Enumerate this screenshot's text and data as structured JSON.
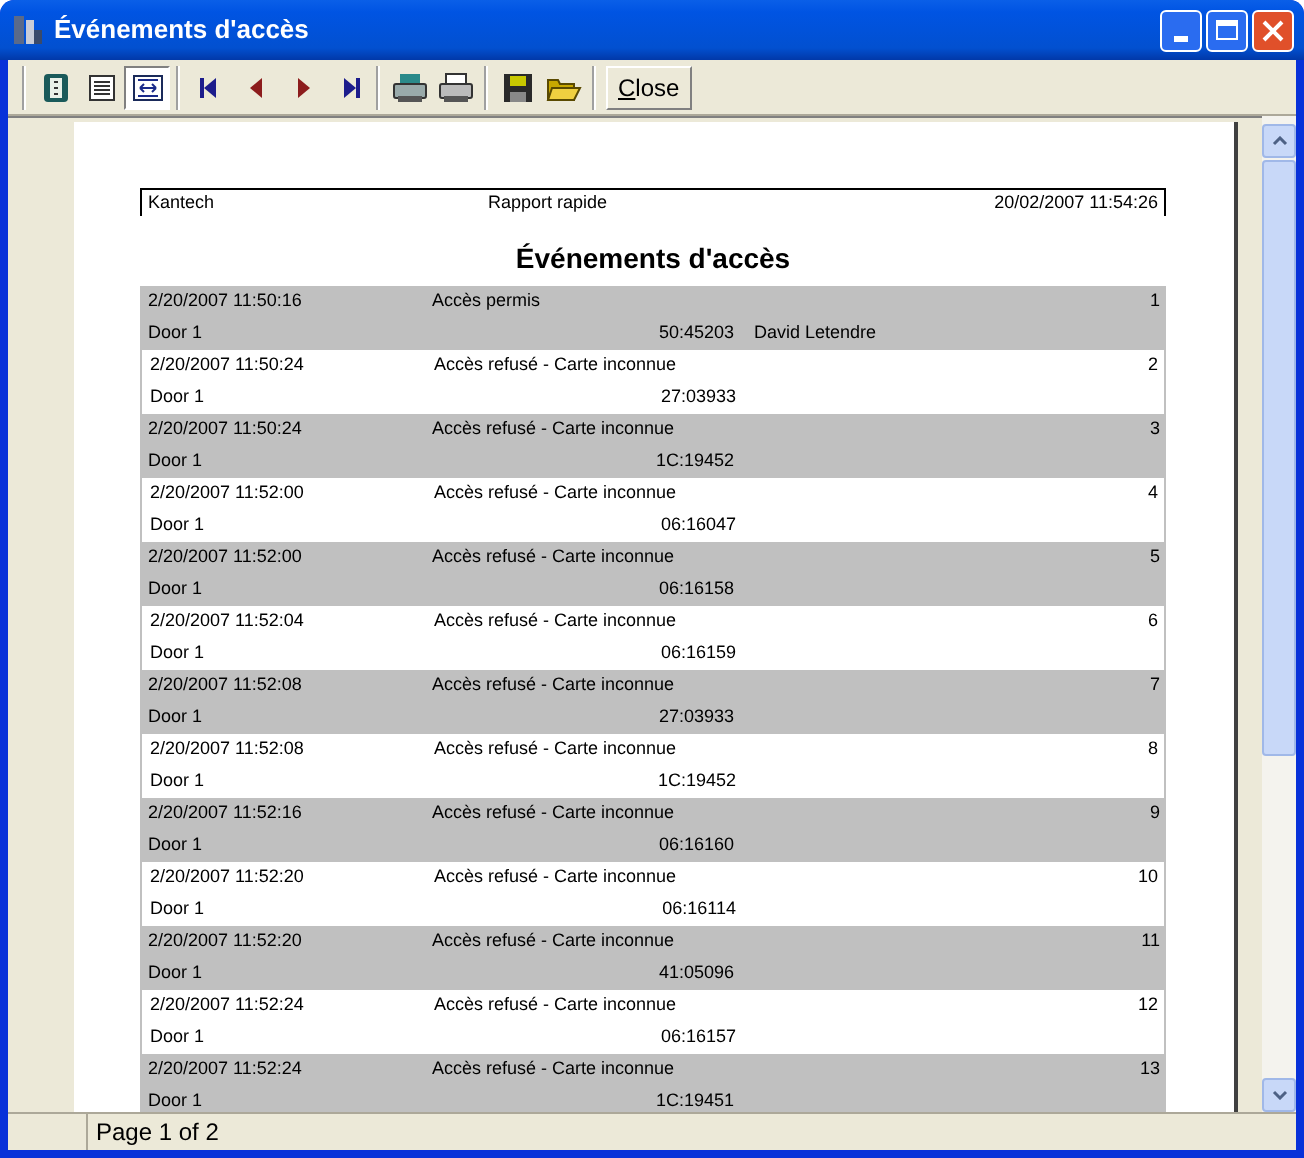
{
  "window": {
    "title": "Événements d'accès"
  },
  "toolbar": {
    "view_buttons": [
      {
        "selected": false
      },
      {
        "selected": false
      },
      {
        "selected": true
      }
    ],
    "close_button": "Close"
  },
  "report": {
    "header": {
      "company": "Kantech",
      "report_name": "Rapport rapide",
      "printed_at": "20/02/2007 11:54:26"
    },
    "title": "Événements d'accès",
    "rows": [
      {
        "date": "2/20/2007 11:50:16",
        "event": "Accès permis",
        "number": "1",
        "door": "Door 1",
        "card": "50:45203",
        "name": "David Letendre"
      },
      {
        "date": "2/20/2007 11:50:24",
        "event": "Accès refusé - Carte inconnue",
        "number": "2",
        "door": "Door 1",
        "card": "27:03933"
      },
      {
        "date": "2/20/2007 11:50:24",
        "event": "Accès refusé - Carte inconnue",
        "number": "3",
        "door": "Door 1",
        "card": "1C:19452"
      },
      {
        "date": "2/20/2007 11:52:00",
        "event": "Accès refusé - Carte inconnue",
        "number": "4",
        "door": "Door 1",
        "card": "06:16047"
      },
      {
        "date": "2/20/2007 11:52:00",
        "event": "Accès refusé - Carte inconnue",
        "number": "5",
        "door": "Door 1",
        "card": "06:16158"
      },
      {
        "date": "2/20/2007 11:52:04",
        "event": "Accès refusé - Carte inconnue",
        "number": "6",
        "door": "Door 1",
        "card": "06:16159"
      },
      {
        "date": "2/20/2007 11:52:08",
        "event": "Accès refusé - Carte inconnue",
        "number": "7",
        "door": "Door 1",
        "card": "27:03933"
      },
      {
        "date": "2/20/2007 11:52:08",
        "event": "Accès refusé - Carte inconnue",
        "number": "8",
        "door": "Door 1",
        "card": "1C:19452"
      },
      {
        "date": "2/20/2007 11:52:16",
        "event": "Accès refusé - Carte inconnue",
        "number": "9",
        "door": "Door 1",
        "card": "06:16160"
      },
      {
        "date": "2/20/2007 11:52:20",
        "event": "Accès refusé - Carte inconnue",
        "number": "10",
        "door": "Door 1",
        "card": "06:16114"
      },
      {
        "date": "2/20/2007 11:52:20",
        "event": "Accès refusé - Carte inconnue",
        "number": "11",
        "door": "Door 1",
        "card": "41:05096"
      },
      {
        "date": "2/20/2007 11:52:24",
        "event": "Accès refusé - Carte inconnue",
        "number": "12",
        "door": "Door 1",
        "card": "06:16157"
      },
      {
        "date": "2/20/2007 11:52:24",
        "event": "Accès refusé - Carte inconnue",
        "number": "13",
        "door": "Door 1",
        "card": "1C:19451"
      }
    ]
  },
  "status_bar": {
    "page": "Page 1 of 2"
  }
}
